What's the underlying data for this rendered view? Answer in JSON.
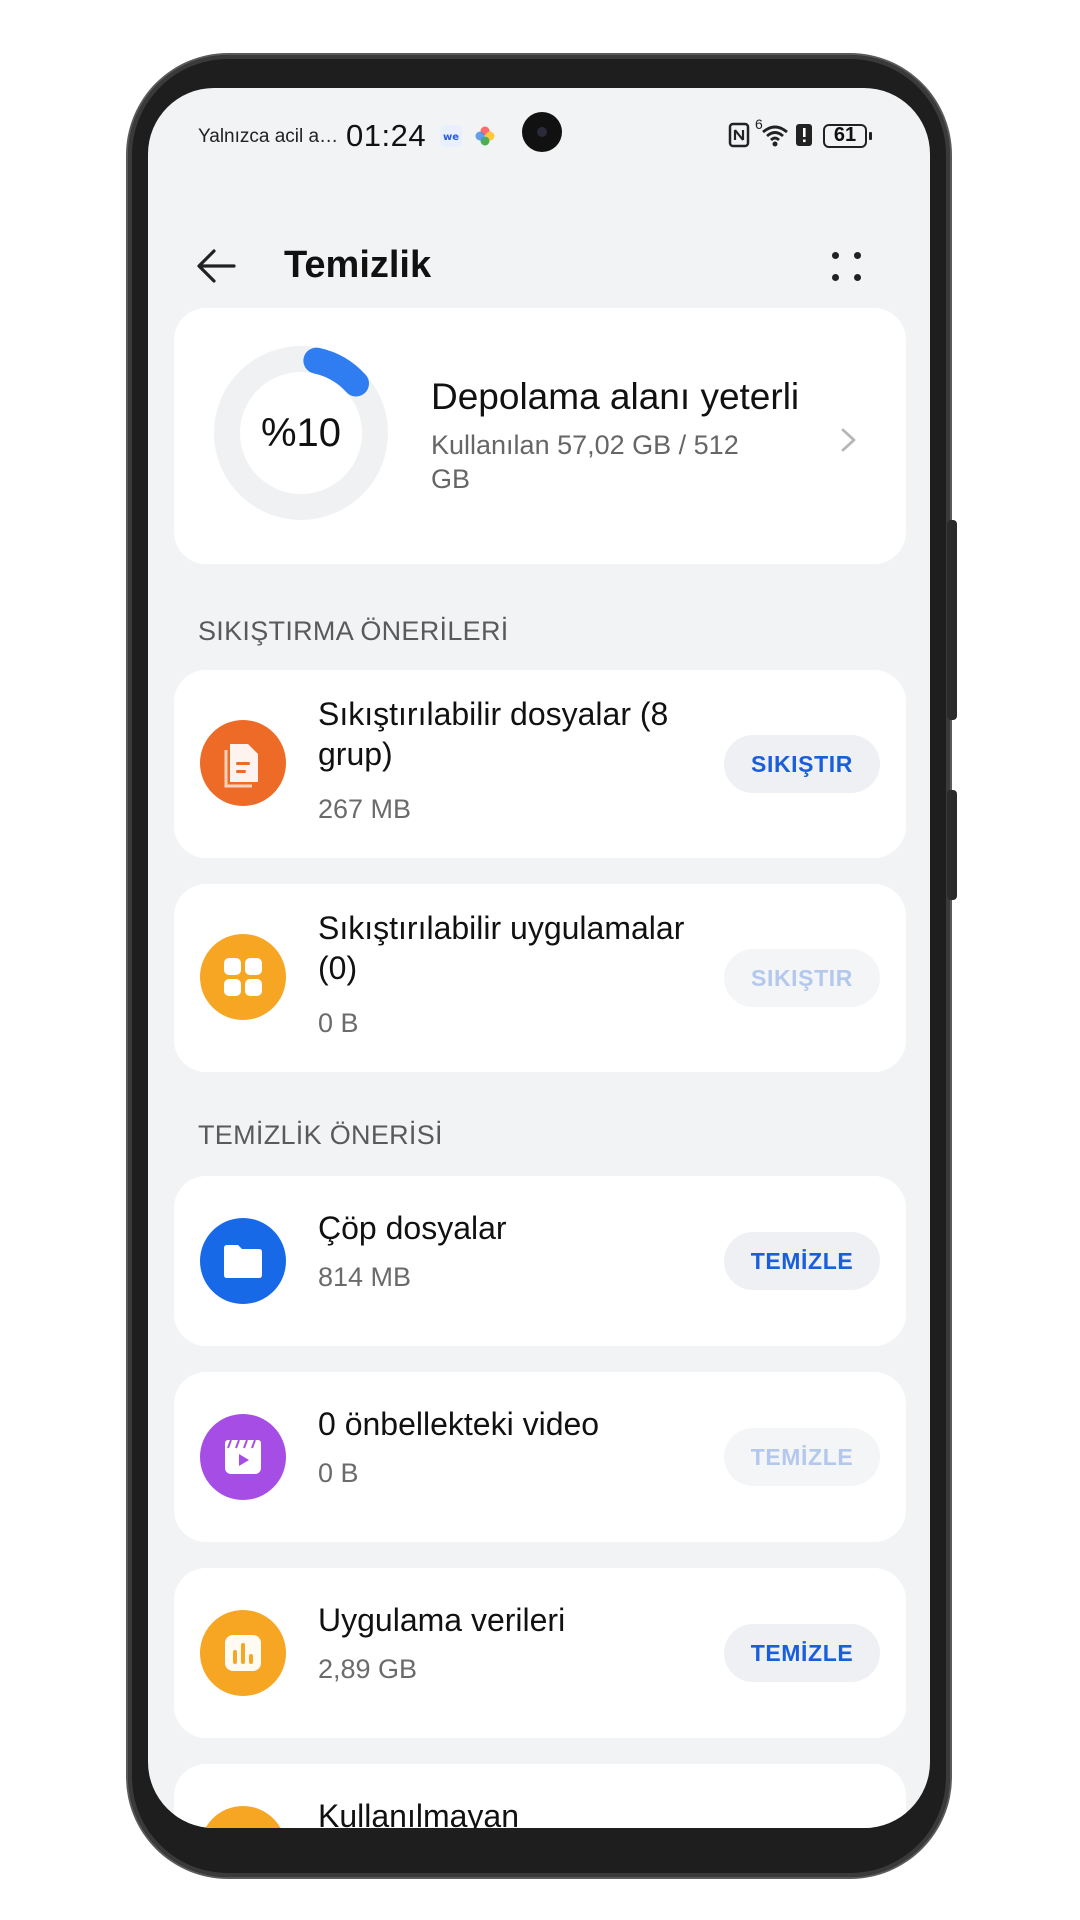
{
  "status_bar": {
    "emergency_text": "Yalnızca acil a…",
    "time": "01:24",
    "network_label": "6",
    "battery": "61"
  },
  "header": {
    "title": "Temizlik"
  },
  "storage": {
    "percent_text": "%10",
    "percent_value": 10,
    "status_title": "Depolama alanı yeterli",
    "used_text": "Kullanılan 57,02 GB / 512 GB"
  },
  "compress_section": {
    "title": "SIKIŞTIRMA ÖNERİLERİ",
    "items": [
      {
        "label": "Sıkıştırılabilir dosyalar (8 grup)",
        "size": "267 MB",
        "action": "SIKIŞTIR",
        "enabled": true,
        "icon": "document-icon",
        "color": "#ee6a27"
      },
      {
        "label": "Sıkıştırılabilir uygulamalar (0)",
        "size": "0 B",
        "action": "SIKIŞTIR",
        "enabled": false,
        "icon": "apps-grid-icon",
        "color": "#f6a623"
      }
    ]
  },
  "clean_section": {
    "title": "TEMİZLİK ÖNERİSİ",
    "items": [
      {
        "label": "Çöp dosyalar",
        "size": "814 MB",
        "action": "TEMİZLE",
        "enabled": true,
        "icon": "folder-icon",
        "color": "#1769e8"
      },
      {
        "label": "0 önbellekteki video",
        "size": "0 B",
        "action": "TEMİZLE",
        "enabled": false,
        "icon": "video-icon",
        "color": "#a64de6"
      },
      {
        "label": "Uygulama verileri",
        "size": "2,89 GB",
        "action": "TEMİZLE",
        "enabled": true,
        "icon": "bar-chart-icon",
        "color": "#f6a623"
      },
      {
        "label": "Kullanılmayan",
        "icon": "app-icon",
        "color": "#f6a623"
      }
    ]
  },
  "colors": {
    "accent": "#1a5fd8",
    "ring_progress": "#2f7df0",
    "ring_track": "#f0f1f3",
    "background": "#f1f3f5"
  }
}
